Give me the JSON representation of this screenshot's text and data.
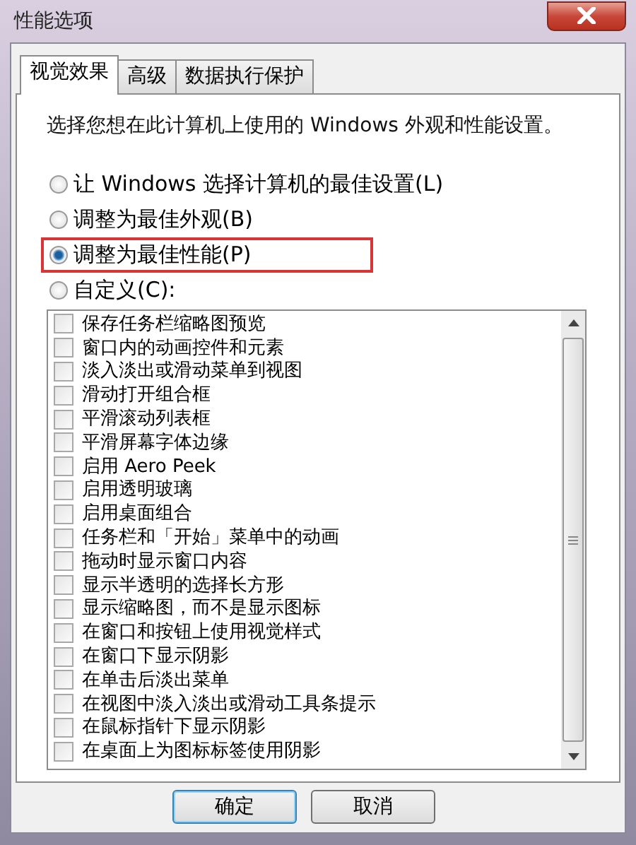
{
  "window": {
    "title": "性能选项"
  },
  "tabs": [
    {
      "label": "视觉效果",
      "selected": true
    },
    {
      "label": "高级",
      "selected": false
    },
    {
      "label": "数据执行保护",
      "selected": false
    }
  ],
  "description": "选择您想在此计算机上使用的 Windows 外观和性能设置。",
  "options": [
    {
      "label": "让 Windows 选择计算机的最佳设置(L)",
      "selected": false,
      "highlighted": false
    },
    {
      "label": "调整为最佳外观(B)",
      "selected": false,
      "highlighted": false
    },
    {
      "label": "调整为最佳性能(P)",
      "selected": true,
      "highlighted": true
    },
    {
      "label": "自定义(C):",
      "selected": false,
      "highlighted": false
    }
  ],
  "effects": [
    {
      "label": "保存任务栏缩略图预览",
      "checked": false
    },
    {
      "label": "窗口内的动画控件和元素",
      "checked": false
    },
    {
      "label": "淡入淡出或滑动菜单到视图",
      "checked": false
    },
    {
      "label": "滑动打开组合框",
      "checked": false
    },
    {
      "label": "平滑滚动列表框",
      "checked": false
    },
    {
      "label": "平滑屏幕字体边缘",
      "checked": false
    },
    {
      "label": "启用 Aero Peek",
      "checked": false
    },
    {
      "label": "启用透明玻璃",
      "checked": false
    },
    {
      "label": "启用桌面组合",
      "checked": false
    },
    {
      "label": "任务栏和「开始」菜单中的动画",
      "checked": false
    },
    {
      "label": "拖动时显示窗口内容",
      "checked": false
    },
    {
      "label": "显示半透明的选择长方形",
      "checked": false
    },
    {
      "label": "显示缩略图，而不是显示图标",
      "checked": false
    },
    {
      "label": "在窗口和按钮上使用视觉样式",
      "checked": false
    },
    {
      "label": "在窗口下显示阴影",
      "checked": false
    },
    {
      "label": "在单击后淡出菜单",
      "checked": false
    },
    {
      "label": "在视图中淡入淡出或滑动工具条提示",
      "checked": false
    },
    {
      "label": "在鼠标指针下显示阴影",
      "checked": false
    },
    {
      "label": "在桌面上为图标标签使用阴影",
      "checked": false
    }
  ],
  "buttons": [
    {
      "label": "确定",
      "kind": "default"
    },
    {
      "label": "取消",
      "kind": "normal"
    }
  ]
}
